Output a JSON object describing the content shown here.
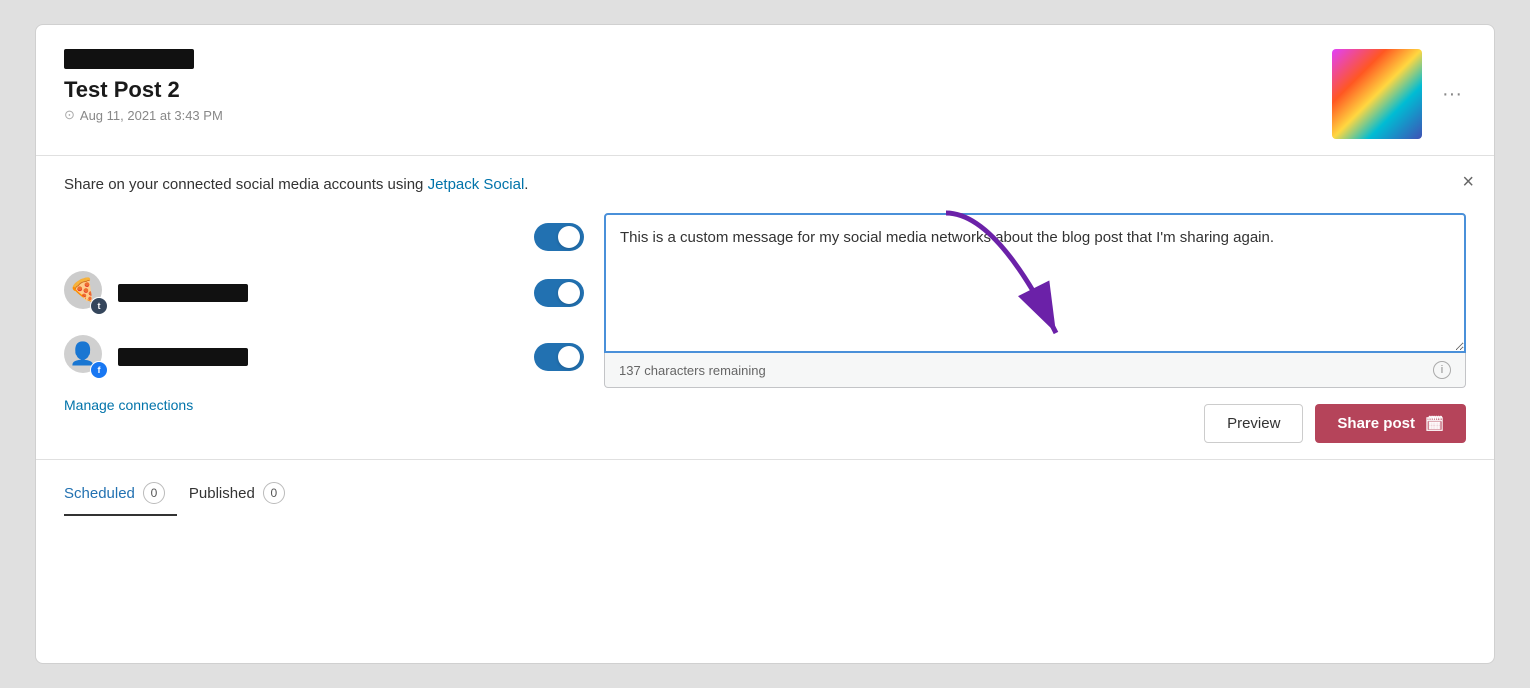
{
  "card": {
    "header": {
      "redacted_bar": "",
      "title": "Test Post 2",
      "date": "Aug 11, 2021 at 3:43 PM",
      "more_icon": "···"
    },
    "body": {
      "share_text_prefix": "Share on your connected social media accounts using ",
      "share_link": "Jetpack Social",
      "share_text_suffix": ".",
      "close_label": "×",
      "accounts": [
        {
          "id": "toggle-only",
          "type": "toggle_only"
        },
        {
          "id": "tumblr-account",
          "social": "tumblr",
          "badge_label": "t",
          "name_redacted": true
        },
        {
          "id": "facebook-account",
          "social": "facebook",
          "badge_label": "f",
          "name_redacted": true
        }
      ],
      "manage_connections": "Manage connections",
      "message": "This is a custom message for my social media networks about the blog post that I'm sharing again.",
      "char_remaining": "137 characters remaining",
      "preview_label": "Preview",
      "share_label": "Share post"
    },
    "footer": {
      "tabs": [
        {
          "id": "scheduled",
          "label": "Scheduled",
          "count": "0",
          "active": true
        },
        {
          "id": "published",
          "label": "Published",
          "count": "0",
          "active": false
        }
      ]
    }
  }
}
